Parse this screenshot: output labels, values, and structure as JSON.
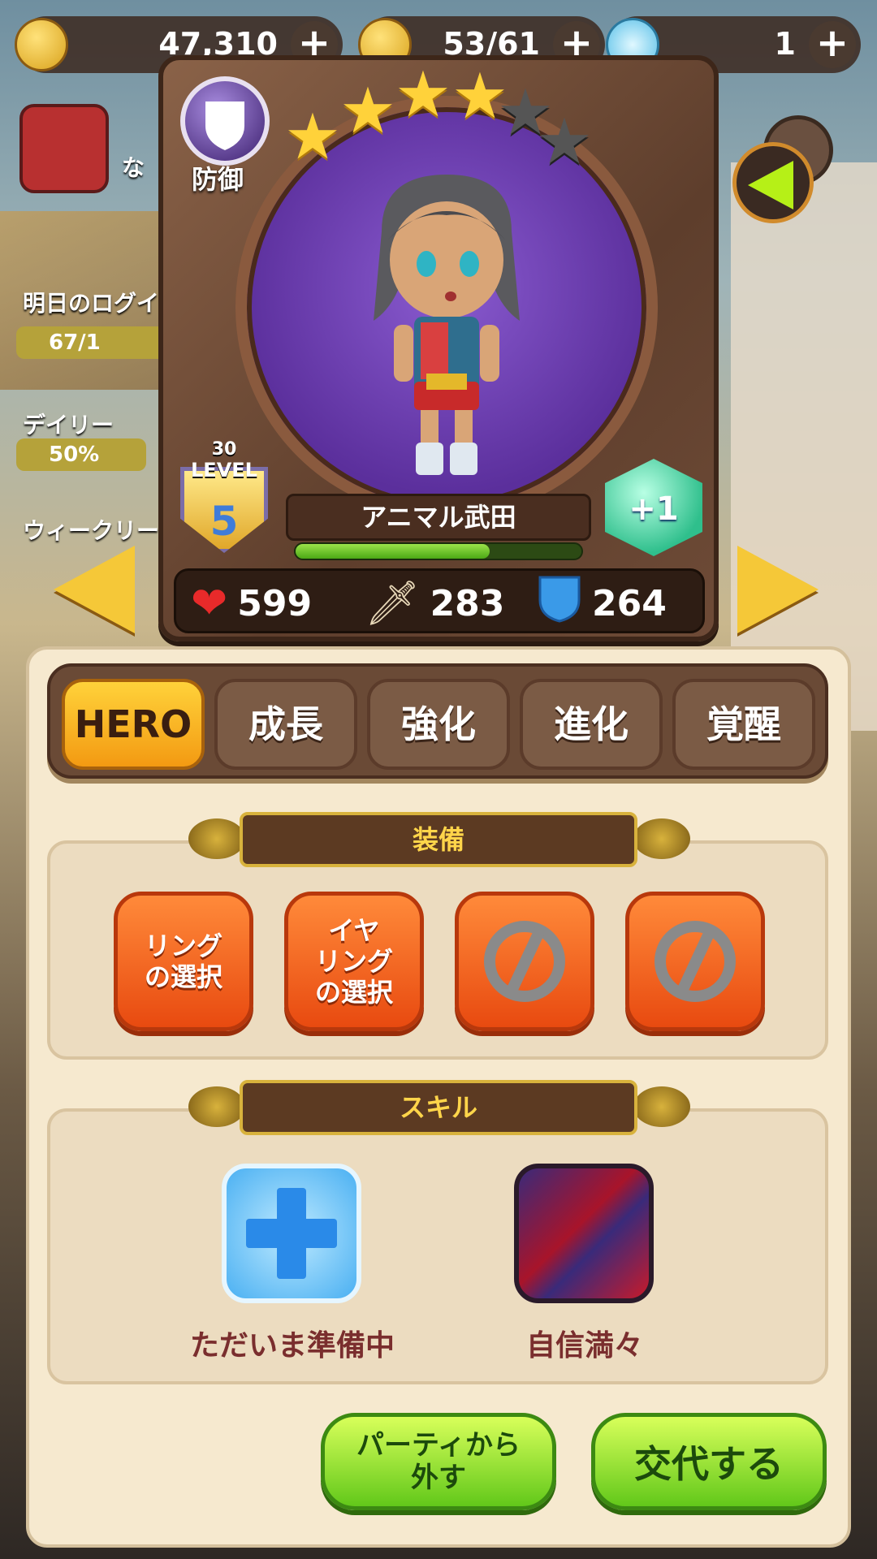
{
  "currency": {
    "coins": "47,310",
    "stamina": "53/61",
    "gems": "1"
  },
  "background": {
    "login_label": "明日のログイ",
    "login_progress": "67/1",
    "daily_label": "デイリー",
    "daily_value": "50%",
    "weekly_label": "ウィークリー",
    "player_name_fragment": "な"
  },
  "hero": {
    "role": "防御",
    "stars_total": 6,
    "stars_filled": 4,
    "level_cap": "30",
    "level_word": "LEVEL",
    "level": "5",
    "name": "アニマル武田",
    "exp_fraction": 0.68,
    "plus": "+1",
    "hp": "599",
    "atk": "283",
    "def": "264"
  },
  "tabs": [
    {
      "label": "HERO",
      "active": true
    },
    {
      "label": "成長",
      "active": false
    },
    {
      "label": "強化",
      "active": false
    },
    {
      "label": "進化",
      "active": false
    },
    {
      "label": "覚醒",
      "active": false
    }
  ],
  "equipment": {
    "title": "装備",
    "ring": "リング\nの選択",
    "earring": "イヤ\nリング\nの選択"
  },
  "skills": {
    "title": "スキル",
    "skill1": "ただいま準備中",
    "skill2": "自信満々"
  },
  "buttons": {
    "remove": "パーティから\n外す",
    "swap": "交代する"
  },
  "colors": {
    "accent": "#f39a12",
    "panel": "#f6e9cf",
    "button_green": "#62c81a",
    "equip_orange": "#e84a10"
  }
}
